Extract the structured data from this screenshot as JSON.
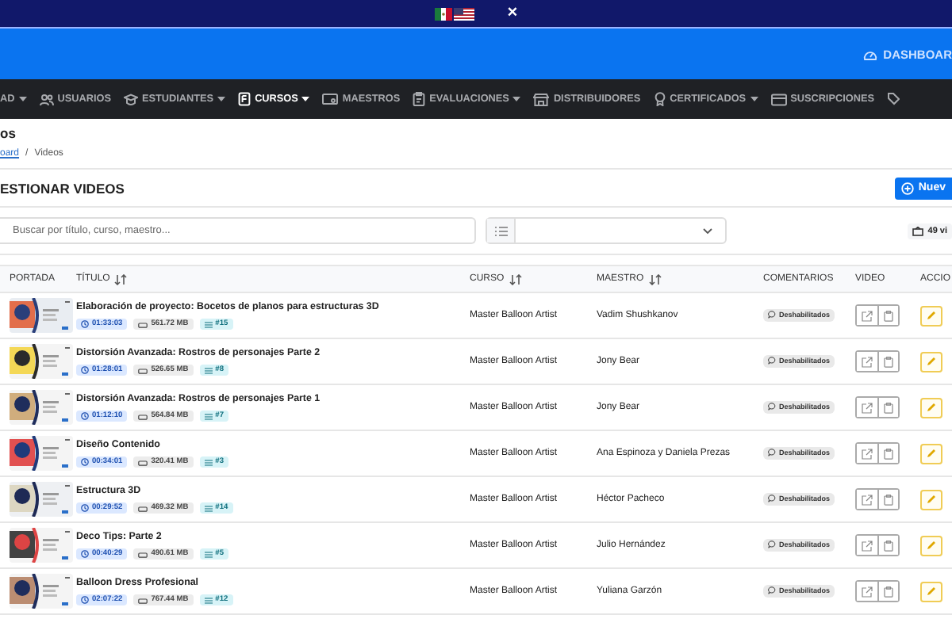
{
  "top_strip": {
    "close": "×"
  },
  "header": {
    "dashboard": "DASHBOAR"
  },
  "nav": [
    {
      "label": "AD",
      "dropdown": true,
      "selected": false
    },
    {
      "label": "USUARIOS",
      "dropdown": false,
      "selected": false
    },
    {
      "label": "ESTUDIANTES",
      "dropdown": true,
      "selected": false
    },
    {
      "label": "CURSOS",
      "dropdown": true,
      "selected": true
    },
    {
      "label": "MAESTROS",
      "dropdown": false,
      "selected": false
    },
    {
      "label": "EVALUACIONES",
      "dropdown": true,
      "selected": false
    },
    {
      "label": "DISTRIBUIDORES",
      "dropdown": false,
      "selected": false
    },
    {
      "label": "CERTIFICADOS",
      "dropdown": true,
      "selected": false
    },
    {
      "label": "SUSCRIPCIONES",
      "dropdown": false,
      "selected": false
    }
  ],
  "page": {
    "title": "os",
    "breadcrumb_link": "oard",
    "breadcrumb_sep": "/",
    "breadcrumb_current": "Videos"
  },
  "card": {
    "title": "ESTIONAR VIDEOS",
    "new_button": "Nuev",
    "search": {
      "placeholder": "Buscar por título, curso, maestro..."
    },
    "count": "49 vi"
  },
  "table": {
    "columns": [
      {
        "label": "PORTADA",
        "sortable": false
      },
      {
        "label": "TÍTULO",
        "sortable": true
      },
      {
        "label": "CURSO",
        "sortable": true
      },
      {
        "label": "MAESTRO",
        "sortable": true
      },
      {
        "label": "COMENTARIOS",
        "sortable": false
      },
      {
        "label": "VIDEO",
        "sortable": false
      },
      {
        "label": "ACCIO",
        "sortable": false
      }
    ],
    "rows": [
      {
        "title": "Elaboración de proyecto: Bocetos de planos para estructuras 3D",
        "duration": "01:33:03",
        "size": "561.72 MB",
        "order": "#15",
        "course": "Master Balloon Artist",
        "teacher": "Vadim Shushkanov",
        "comments": "Deshabilitados"
      },
      {
        "title": "Distorsión Avanzada: Rostros de personajes Parte 2",
        "duration": "01:28:01",
        "size": "526.65 MB",
        "order": "#8",
        "course": "Master Balloon Artist",
        "teacher": "Jony Bear",
        "comments": "Deshabilitados"
      },
      {
        "title": "Distorsión Avanzada: Rostros de personajes Parte 1",
        "duration": "01:12:10",
        "size": "564.84 MB",
        "order": "#7",
        "course": "Master Balloon Artist",
        "teacher": "Jony Bear",
        "comments": "Deshabilitados"
      },
      {
        "title": "Diseño Contenido",
        "duration": "00:34:01",
        "size": "320.41 MB",
        "order": "#3",
        "course": "Master Balloon Artist",
        "teacher": "Ana Espinoza y Daniela Prezas",
        "comments": "Deshabilitados"
      },
      {
        "title": "Estructura 3D",
        "duration": "00:29:52",
        "size": "469.32 MB",
        "order": "#14",
        "course": "Master Balloon Artist",
        "teacher": "Héctor Pacheco",
        "comments": "Deshabilitados"
      },
      {
        "title": "Deco Tips: Parte 2",
        "duration": "00:40:29",
        "size": "490.61 MB",
        "order": "#5",
        "course": "Master Balloon Artist",
        "teacher": "Julio Hernández",
        "comments": "Deshabilitados"
      },
      {
        "title": "Balloon Dress Profesional",
        "duration": "02:07:22",
        "size": "767.44 MB",
        "order": "#12",
        "course": "Master Balloon Artist",
        "teacher": "Yuliana Garzón",
        "comments": "Deshabilitados"
      }
    ]
  }
}
